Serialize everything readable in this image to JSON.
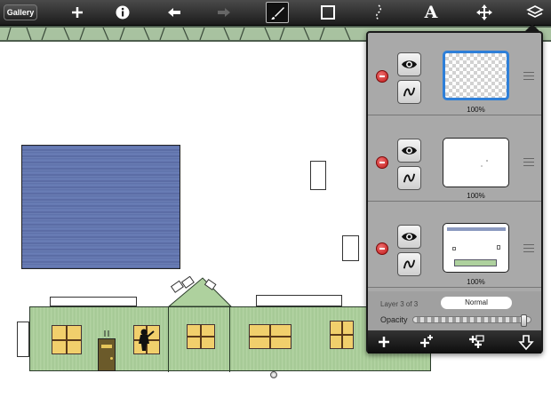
{
  "toolbar": {
    "gallery_label": "Gallery",
    "text_tool_glyph": "A",
    "icons": [
      "add-icon",
      "info-icon",
      "undo-icon",
      "redo-icon",
      "brush-icon",
      "rectangle-icon",
      "selection-icon",
      "text-icon",
      "transform-icon",
      "layers-icon"
    ]
  },
  "layers": {
    "rows": [
      {
        "opacity_label": "100%",
        "visible": true,
        "selected": true,
        "thumbnail": "transparent"
      },
      {
        "opacity_label": "100%",
        "visible": true,
        "selected": false,
        "thumbnail": "blank"
      },
      {
        "opacity_label": "100%",
        "visible": true,
        "selected": false,
        "thumbnail": "house-drawing"
      }
    ],
    "count_label": "Layer 3 of 3",
    "blend_mode": "Normal",
    "opacity_label": "Opacity",
    "opacity_value": 0.97
  },
  "bottom_bar_icons": [
    "add-layer-icon",
    "duplicate-layer-icon",
    "merge-layer-icon",
    "move-layer-down-icon"
  ],
  "colors": {
    "selected_border": "#2e7fd8",
    "house_green": "#aed19e",
    "window_yellow": "#f1cf6c",
    "sky_blue": "#5c6fa8"
  }
}
